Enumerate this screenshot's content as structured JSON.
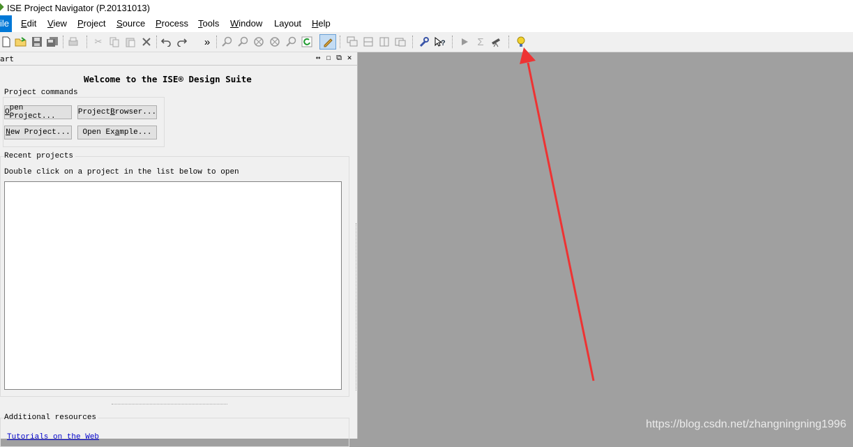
{
  "window": {
    "title": "ISE Project Navigator (P.20131013)"
  },
  "menu": [
    {
      "label": "File",
      "ul": "F",
      "rest": "ile"
    },
    {
      "label": "Edit",
      "ul": "E",
      "rest": "dit"
    },
    {
      "label": "View",
      "ul": "V",
      "rest": "iew"
    },
    {
      "label": "Project",
      "ul": "P",
      "rest": "roject"
    },
    {
      "label": "Source",
      "ul": "S",
      "rest": "ource"
    },
    {
      "label": "Process",
      "ul": "P",
      "rest": "rocess"
    },
    {
      "label": "Tools",
      "ul": "T",
      "rest": "ools"
    },
    {
      "label": "Window",
      "ul": "W",
      "rest": "indow"
    },
    {
      "label": "Layout",
      "ul": "",
      "rest": "Layout"
    },
    {
      "label": "Help",
      "ul": "H",
      "rest": "elp"
    }
  ],
  "menu_visible": {
    "file": "ile",
    "edit_ul": "E",
    "edit": "dit",
    "view_ul": "V",
    "view": "iew",
    "project_ul": "P",
    "project": "roject",
    "source_ul": "S",
    "source": "ource",
    "process_ul": "P",
    "process": "rocess",
    "tools_ul": "T",
    "tools": "ools",
    "window_ul": "W",
    "window": "indow",
    "layout": "Layout",
    "help_ul": "H",
    "help": "elp"
  },
  "toolbar": {
    "overflow": "»",
    "icons": [
      "new-file-icon",
      "open-file-icon",
      "save-icon",
      "save-all-icon",
      "print-icon",
      "cut-icon",
      "copy-icon",
      "paste-icon",
      "delete-icon",
      "undo-icon",
      "redo-icon",
      "zoom-in-icon",
      "zoom-out-icon",
      "zoom-fit-icon",
      "zoom-full-icon",
      "zoom-select-icon",
      "refresh-icon",
      "edit-icon",
      "cascade-icon",
      "tile-horizontal-icon",
      "tile-vertical-icon",
      "float-icon",
      "settings-icon",
      "help-context-icon",
      "run-icon",
      "sum-icon",
      "telescope-icon",
      "lightbulb-icon"
    ]
  },
  "start_panel": {
    "title": "art",
    "welcome": "Welcome to the ISE® Design Suite",
    "project_commands_label": "Project commands",
    "buttons": {
      "open_project": {
        "ul": "O",
        "rest": "pen Project..."
      },
      "project_browser_pre": "Project ",
      "project_browser_ul": "B",
      "project_browser_rest": "rowser...",
      "new_project": {
        "ul": "N",
        "rest": "ew Project..."
      },
      "open_example_pre": "Open Ex",
      "open_example_ul": "a",
      "open_example_rest": "mple..."
    },
    "recent_label": "Recent projects",
    "recent_hint": "Double click on a project in the list below to open",
    "recent_items": [],
    "additional_label": "Additional resources",
    "tutorials_link": "Tutorials on the Web"
  },
  "watermark": "https://blog.csdn.net/zhangningning1996",
  "colors": {
    "accent": "#0078d7",
    "workspace": "#a0a0a0",
    "arrow": "#ee3333",
    "bulb": "#f2d22e"
  }
}
